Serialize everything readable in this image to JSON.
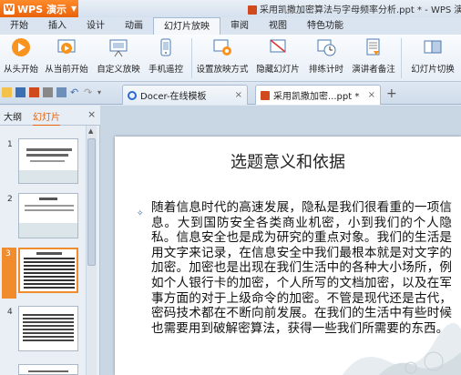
{
  "app": {
    "name": "WPS 演示"
  },
  "document": {
    "title": "采用凯撒加密算法与字母频率分析.ppt * - WPS 演示"
  },
  "menu": {
    "items": [
      "开始",
      "插入",
      "设计",
      "动画",
      "幻灯片放映",
      "审阅",
      "视图",
      "特色功能"
    ],
    "active_index": 4
  },
  "ribbon": {
    "buttons": [
      "从头开始",
      "从当前开始",
      "自定义放映",
      "手机遥控",
      "设置放映方式",
      "隐藏幻灯片",
      "排练计时",
      "演讲者备注",
      "幻灯片切换"
    ]
  },
  "tabs": {
    "items": [
      {
        "label": "Docer-在线模板",
        "active": false
      },
      {
        "label": "采用凯撒加密...ppt *",
        "active": true
      }
    ]
  },
  "panel": {
    "tabs": [
      "大纲",
      "幻灯片"
    ],
    "active_index": 1
  },
  "thumbnails": {
    "numbers": [
      "1",
      "2",
      "3",
      "4"
    ],
    "selected_index": 2
  },
  "slide": {
    "title": "选题意义和依据",
    "body": "随着信息时代的高速发展，隐私是我们很看重的一项信息。大到国防安全各类商业机密，小到我们的个人隐私。信息安全也是成为研究的重点对象。我们的生活是用文字来记录，在信息安全中我们最根本就是对文字的加密。加密也是出现在我们生活中的各种大小场所，例如个人银行卡的加密，个人所写的文档加密，以及在军事方面的对于上级命令的加密。不管是现代还是古代，密码技术都在不断向前发展。在我们的生活中有些时候也需要用到破解密算法，获得一些我们所需要的东西。"
  },
  "colors": {
    "accent": "#e9620a",
    "ribbon_bg": "#eef3f9",
    "canvas_bg": "#c9d6e4"
  }
}
